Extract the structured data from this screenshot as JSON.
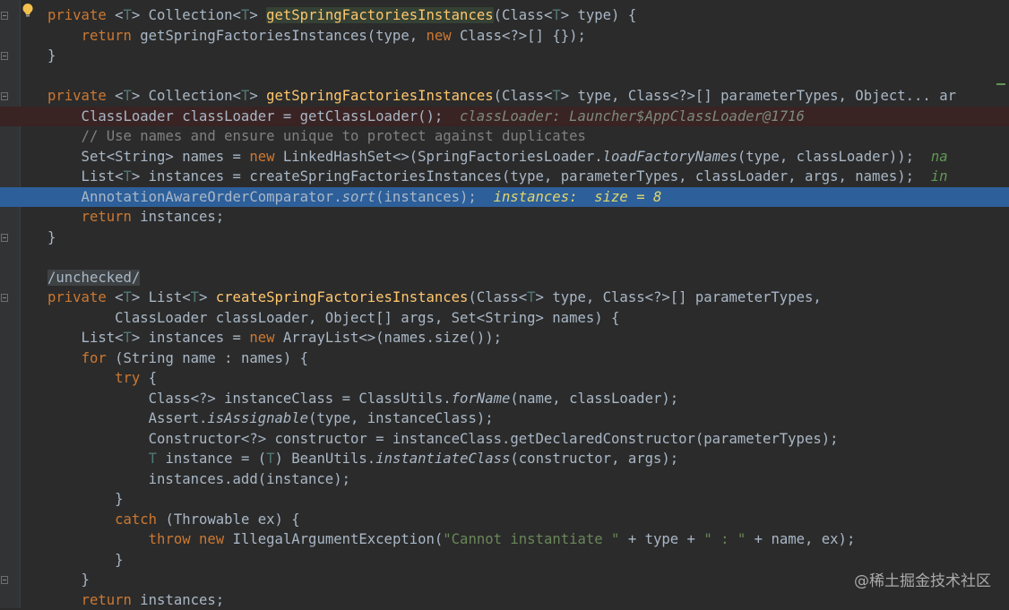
{
  "editor": {
    "lines": [
      {
        "segs": [
          [
            "kw",
            "private "
          ],
          [
            "pl",
            "<"
          ],
          [
            "tp",
            "T"
          ],
          [
            "pl",
            "> Collection<"
          ],
          [
            "tp",
            "T"
          ],
          [
            "pl",
            "> "
          ],
          [
            "caret",
            ""
          ],
          [
            "sel",
            "getSpringFactoriesInstances"
          ],
          [
            "pl",
            "(Class<"
          ],
          [
            "tp",
            "T"
          ],
          [
            "pl",
            "> type) {"
          ]
        ]
      },
      {
        "segs": [
          [
            "pl",
            "    "
          ],
          [
            "kw",
            "return "
          ],
          [
            "pl",
            "getSpringFactoriesInstances(type, "
          ],
          [
            "kw",
            "new "
          ],
          [
            "pl",
            "Class<?>[] {});"
          ]
        ]
      },
      {
        "segs": [
          [
            "pl",
            "}"
          ]
        ]
      },
      {
        "segs": []
      },
      {
        "segs": [
          [
            "kw",
            "private "
          ],
          [
            "pl",
            "<"
          ],
          [
            "tp",
            "T"
          ],
          [
            "pl",
            "> Collection<"
          ],
          [
            "tp",
            "T"
          ],
          [
            "pl",
            "> "
          ],
          [
            "fn",
            "getSpringFactoriesInstances"
          ],
          [
            "pl",
            "(Class<"
          ],
          [
            "tp",
            "T"
          ],
          [
            "pl",
            "> type, Class<?>[] parameterTypes, Object... ar"
          ]
        ]
      },
      {
        "hl": "error",
        "segs": [
          [
            "pl",
            "    ClassLoader classLoader = getClassLoader();  "
          ],
          [
            "dbg",
            "classLoader: Launcher$AppClassLoader@1716"
          ]
        ]
      },
      {
        "segs": [
          [
            "pl",
            "    "
          ],
          [
            "cm",
            "// Use names and ensure unique to protect against duplicates"
          ]
        ]
      },
      {
        "segs": [
          [
            "pl",
            "    Set<String> names = "
          ],
          [
            "kw",
            "new "
          ],
          [
            "pl",
            "LinkedHashSet<>(SpringFactoriesLoader."
          ],
          [
            "it",
            "loadFactoryNames"
          ],
          [
            "pl",
            "(type, classLoader));  "
          ],
          [
            "dbgg",
            "na"
          ]
        ]
      },
      {
        "segs": [
          [
            "pl",
            "    List<"
          ],
          [
            "tp",
            "T"
          ],
          [
            "pl",
            "> instances = createSpringFactoriesInstances(type, parameterTypes, classLoader, args, names);  "
          ],
          [
            "dbgg",
            "in"
          ]
        ]
      },
      {
        "hl": "exec",
        "segs": [
          [
            "pl",
            "    AnnotationAwareOrderComparator."
          ],
          [
            "it",
            "sort"
          ],
          [
            "pl",
            "(instances);  "
          ],
          [
            "dbgs",
            "instances:  size = 8"
          ]
        ]
      },
      {
        "segs": [
          [
            "pl",
            "    "
          ],
          [
            "kw",
            "return "
          ],
          [
            "pl",
            "instances;"
          ]
        ]
      },
      {
        "segs": [
          [
            "pl",
            "}"
          ]
        ]
      },
      {
        "segs": []
      },
      {
        "segs": [
          [
            "annbg",
            "/unchecked/"
          ]
        ]
      },
      {
        "segs": [
          [
            "kw",
            "private "
          ],
          [
            "pl",
            "<"
          ],
          [
            "tp",
            "T"
          ],
          [
            "pl",
            "> List<"
          ],
          [
            "tp",
            "T"
          ],
          [
            "pl",
            "> "
          ],
          [
            "fn",
            "createSpringFactoriesInstances"
          ],
          [
            "pl",
            "(Class<"
          ],
          [
            "tp",
            "T"
          ],
          [
            "pl",
            "> type, Class<?>[] parameterTypes,"
          ]
        ]
      },
      {
        "segs": [
          [
            "pl",
            "        ClassLoader classLoader, Object[] args, Set<String> names) {"
          ]
        ]
      },
      {
        "segs": [
          [
            "pl",
            "    List<"
          ],
          [
            "tp",
            "T"
          ],
          [
            "pl",
            "> instances = "
          ],
          [
            "kw",
            "new "
          ],
          [
            "pl",
            "ArrayList<>(names.size());"
          ]
        ]
      },
      {
        "segs": [
          [
            "pl",
            "    "
          ],
          [
            "kw",
            "for "
          ],
          [
            "pl",
            "(String name : names) {"
          ]
        ]
      },
      {
        "segs": [
          [
            "pl",
            "        "
          ],
          [
            "kw",
            "try "
          ],
          [
            "pl",
            "{"
          ]
        ]
      },
      {
        "segs": [
          [
            "pl",
            "            Class<?> instanceClass = ClassUtils."
          ],
          [
            "it",
            "forName"
          ],
          [
            "pl",
            "(name, classLoader);"
          ]
        ]
      },
      {
        "segs": [
          [
            "pl",
            "            Assert."
          ],
          [
            "it",
            "isAssignable"
          ],
          [
            "pl",
            "(type, instanceClass);"
          ]
        ]
      },
      {
        "segs": [
          [
            "pl",
            "            Constructor<?> constructor = instanceClass.getDeclaredConstructor(parameterTypes);"
          ]
        ]
      },
      {
        "segs": [
          [
            "pl",
            "            "
          ],
          [
            "tp",
            "T "
          ],
          [
            "pl",
            "instance = ("
          ],
          [
            "tp",
            "T"
          ],
          [
            "pl",
            ") BeanUtils."
          ],
          [
            "it",
            "instantiateClass"
          ],
          [
            "pl",
            "(constructor, args);"
          ]
        ]
      },
      {
        "segs": [
          [
            "pl",
            "            instances.add(instance);"
          ]
        ]
      },
      {
        "segs": [
          [
            "pl",
            "        }"
          ]
        ]
      },
      {
        "segs": [
          [
            "pl",
            "        "
          ],
          [
            "kw",
            "catch "
          ],
          [
            "pl",
            "(Throwable ex) {"
          ]
        ]
      },
      {
        "segs": [
          [
            "pl",
            "            "
          ],
          [
            "kw",
            "throw new "
          ],
          [
            "pl",
            "IllegalArgumentException("
          ],
          [
            "st",
            "\"Cannot instantiate \""
          ],
          [
            "pl",
            " + type + "
          ],
          [
            "st",
            "\" : \""
          ],
          [
            "pl",
            " + name, ex);"
          ]
        ]
      },
      {
        "segs": [
          [
            "pl",
            "        }"
          ]
        ]
      },
      {
        "segs": [
          [
            "pl",
            "    }"
          ]
        ]
      },
      {
        "segs": [
          [
            "pl",
            "    "
          ],
          [
            "kw",
            "return "
          ],
          [
            "pl",
            "instances;"
          ]
        ]
      }
    ]
  },
  "icons": {
    "intention_bulb": "lightbulb-icon",
    "fold_markers": "fold-icon"
  },
  "watermark": "@稀土掘金技术社区",
  "colors": {
    "background": "#2b2b2b",
    "gutter": "#313335",
    "keyword": "#cc7832",
    "method": "#ffc66d",
    "type_param": "#507874",
    "string": "#6a8759",
    "comment": "#808080",
    "current_line": "#2d5f9a",
    "breakpoint_line": "#3a2323"
  }
}
